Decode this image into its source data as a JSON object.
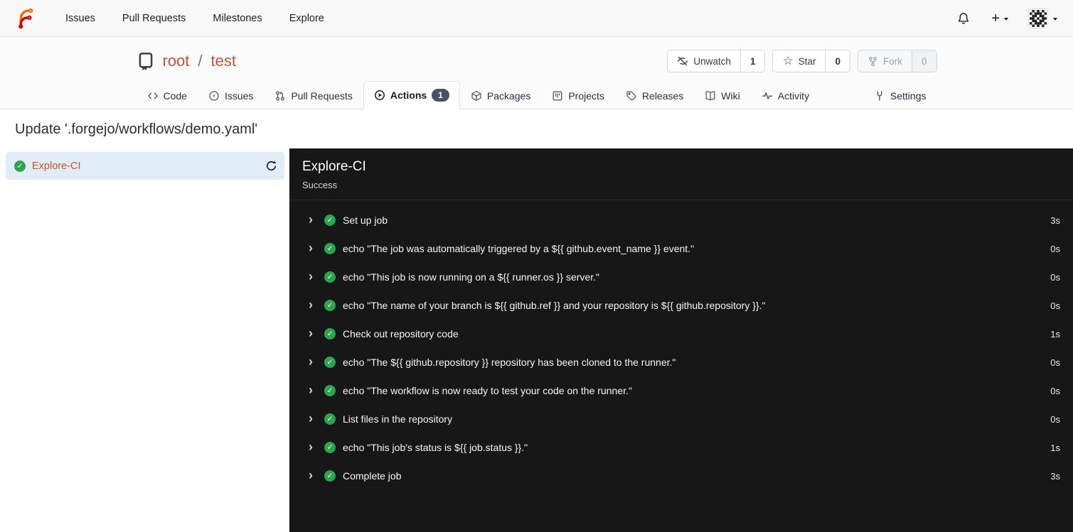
{
  "icons": {
    "plus": "+",
    "star": "☆",
    "check": "✓",
    "chevron_right": "›"
  },
  "navbar": {
    "links": [
      "Issues",
      "Pull Requests",
      "Milestones",
      "Explore"
    ]
  },
  "repo_header": {
    "owner": "root",
    "separator": "/",
    "name": "test",
    "watch": {
      "label": "Unwatch",
      "count": "1"
    },
    "star": {
      "label": "Star",
      "count": "0"
    },
    "fork": {
      "label": "Fork",
      "count": "0"
    }
  },
  "tabs": {
    "code": "Code",
    "issues": "Issues",
    "pull_requests": "Pull Requests",
    "actions": "Actions",
    "actions_badge": "1",
    "packages": "Packages",
    "projects": "Projects",
    "releases": "Releases",
    "wiki": "Wiki",
    "activity": "Activity",
    "settings": "Settings"
  },
  "run": {
    "title": "Update '.forgejo/workflows/demo.yaml'"
  },
  "sidebar": {
    "job_name": "Explore-CI"
  },
  "panel": {
    "job_name": "Explore-CI",
    "status": "Success",
    "steps": [
      {
        "name": "Set up job",
        "duration": "3s"
      },
      {
        "name": "echo \"The job was automatically triggered by a ${{ github.event_name }} event.\"",
        "duration": "0s"
      },
      {
        "name": "echo \"This job is now running on a ${{ runner.os }} server.\"",
        "duration": "0s"
      },
      {
        "name": "echo \"The name of your branch is ${{ github.ref }} and your repository is ${{ github.repository }}.\"",
        "duration": "0s"
      },
      {
        "name": "Check out repository code",
        "duration": "1s"
      },
      {
        "name": "echo \"The ${{ github.repository }} repository has been cloned to the runner.\"",
        "duration": "0s"
      },
      {
        "name": "echo \"The workflow is now ready to test your code on the runner.\"",
        "duration": "0s"
      },
      {
        "name": "List files in the repository",
        "duration": "0s"
      },
      {
        "name": "echo \"This job's status is ${{ job.status }}.\"",
        "duration": "1s"
      },
      {
        "name": "Complete job",
        "duration": "3s"
      }
    ]
  },
  "colors": {
    "brand_link": "#c25435",
    "success_green": "#2da44e",
    "panel_bg": "#171717",
    "selected_job_bg": "#e0ecf6",
    "badge_bg": "#485167",
    "duration_text": "#f2e9df"
  }
}
